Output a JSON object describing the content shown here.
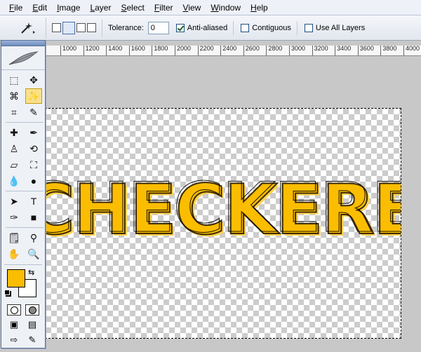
{
  "menu": [
    "File",
    "Edit",
    "Image",
    "Layer",
    "Select",
    "Filter",
    "View",
    "Window",
    "Help"
  ],
  "options": {
    "tolerance_label": "Tolerance:",
    "tolerance_value": "0",
    "anti_aliased_label": "Anti-aliased",
    "anti_aliased_checked": true,
    "contiguous_label": "Contiguous",
    "contiguous_checked": false,
    "use_all_layers_label": "Use All Layers",
    "use_all_layers_checked": false
  },
  "ruler": [
    "1000",
    "1200",
    "1400",
    "1600",
    "1800",
    "2000",
    "2200",
    "2400",
    "2600",
    "2800",
    "3000",
    "3200",
    "3400",
    "3600",
    "3800",
    "4000"
  ],
  "canvas": {
    "text": "CHECKERED"
  },
  "colors": {
    "foreground": "#fbbd00",
    "background": "#ffffff"
  },
  "tools": [
    {
      "name": "marquee-icon",
      "glyph": "⬚"
    },
    {
      "name": "move-icon",
      "glyph": "✥"
    },
    {
      "name": "lasso-icon",
      "glyph": "⌘"
    },
    {
      "name": "magic-wand-icon",
      "glyph": "✨",
      "active": true
    },
    {
      "name": "crop-icon",
      "glyph": "⌗"
    },
    {
      "name": "slice-icon",
      "glyph": "✎"
    },
    {
      "name": "healing-brush-icon",
      "glyph": "✚"
    },
    {
      "name": "brush-icon",
      "glyph": "✒"
    },
    {
      "name": "clone-stamp-icon",
      "glyph": "♙"
    },
    {
      "name": "history-brush-icon",
      "glyph": "⟲"
    },
    {
      "name": "eraser-icon",
      "glyph": "▱"
    },
    {
      "name": "paint-bucket-icon",
      "glyph": "⛶"
    },
    {
      "name": "blur-icon",
      "glyph": "💧"
    },
    {
      "name": "dodge-icon",
      "glyph": "●"
    },
    {
      "name": "path-selection-icon",
      "glyph": "➤"
    },
    {
      "name": "type-icon",
      "glyph": "T"
    },
    {
      "name": "pen-icon",
      "glyph": "✑"
    },
    {
      "name": "shape-icon",
      "glyph": "■"
    },
    {
      "name": "notes-icon",
      "glyph": "🗒"
    },
    {
      "name": "eyedropper-icon",
      "glyph": "⚲"
    },
    {
      "name": "hand-icon",
      "glyph": "✋"
    },
    {
      "name": "zoom-icon",
      "glyph": "🔍"
    }
  ]
}
